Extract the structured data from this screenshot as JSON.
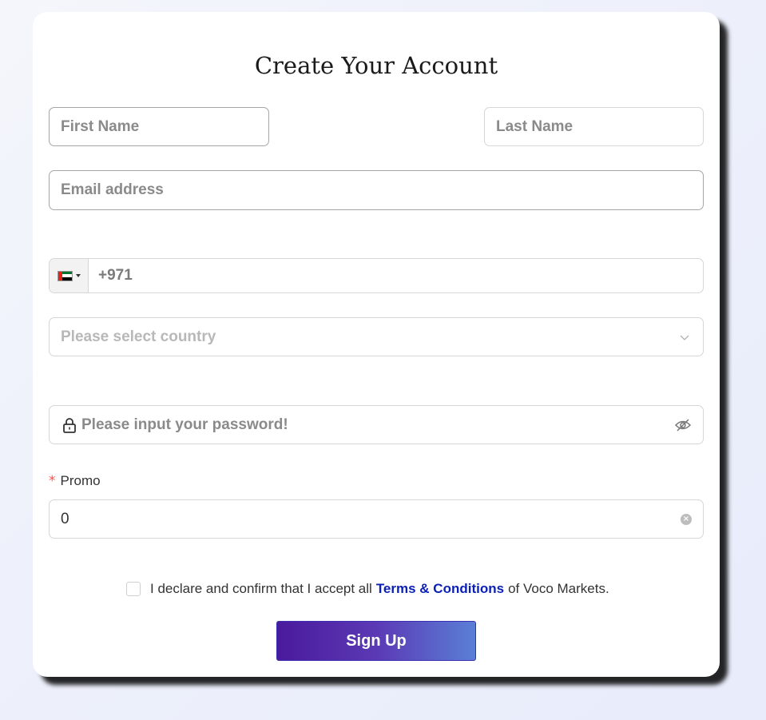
{
  "form": {
    "title": "Create Your Account",
    "first_name_placeholder": "First Name",
    "last_name_placeholder": "Last Name",
    "email_placeholder": "Email address",
    "phone": {
      "country_flag": "uae-flag-icon",
      "value": "+971"
    },
    "country_placeholder": "Please select country",
    "password_placeholder": "Please input your password!",
    "promo": {
      "label": "Promo",
      "required_mark": "*",
      "value": "0"
    },
    "declaration": {
      "prefix": "I declare and confirm that I accept all",
      "link": "Terms & Conditions",
      "suffix": "of Voco Markets."
    },
    "submit_label": "Sign Up"
  },
  "colors": {
    "link": "#0a1fb5",
    "button_gradient_start": "#4a1a9c",
    "button_gradient_end": "#5a7fd6",
    "required": "#ff4d4f"
  }
}
